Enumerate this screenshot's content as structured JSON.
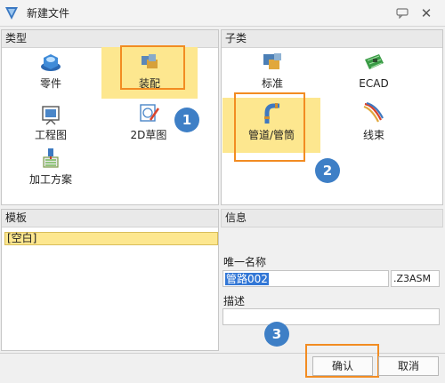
{
  "window": {
    "title": "新建文件",
    "help_icon": "help-icon",
    "close_icon": "close-icon"
  },
  "type_panel": {
    "header": "类型",
    "items": [
      {
        "label": "零件",
        "icon": "part-icon"
      },
      {
        "label": "装配",
        "icon": "assembly-icon",
        "selected": true
      },
      {
        "label": "工程图",
        "icon": "drawing-icon"
      },
      {
        "label": "2D草图",
        "icon": "sketch-2d-icon"
      },
      {
        "label": "加工方案",
        "icon": "machining-icon"
      }
    ]
  },
  "subtype_panel": {
    "header": "子类",
    "items": [
      {
        "label": "标准",
        "icon": "standard-icon"
      },
      {
        "label": "ECAD",
        "icon": "ecad-icon"
      },
      {
        "label": "管道/管筒",
        "icon": "piping-icon",
        "selected": true
      },
      {
        "label": "线束",
        "icon": "harness-icon"
      }
    ]
  },
  "template_panel": {
    "header": "模板",
    "items": [
      {
        "label": "[空白]",
        "selected": true
      }
    ]
  },
  "info_panel": {
    "header": "信息",
    "name_label": "唯一名称",
    "name_value": "管路002",
    "extension": ".Z3ASM",
    "description_label": "描述",
    "description_value": ""
  },
  "buttons": {
    "confirm": "确认",
    "cancel": "取消"
  },
  "annotations": {
    "step1": "1",
    "step2": "2",
    "step3": "3"
  },
  "colors": {
    "selection": "#fde78f",
    "highlight_box": "#f28c22",
    "badge": "#3e7fc6",
    "text_selection": "#3277d6"
  }
}
